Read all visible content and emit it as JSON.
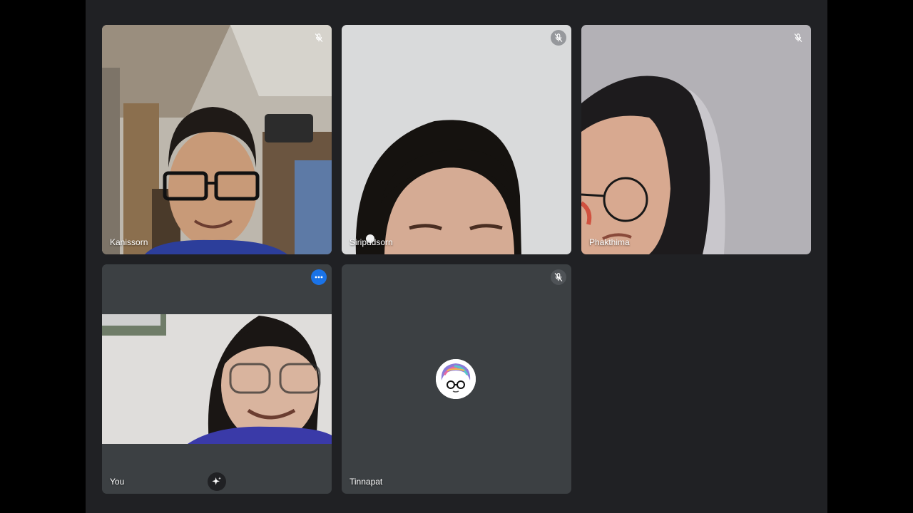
{
  "participants": [
    {
      "name": "Kanissorn",
      "muted": true,
      "mute_icon": "mic-off-icon"
    },
    {
      "name": "Siripudsorn",
      "muted": true,
      "mute_icon": "mic-off-icon"
    },
    {
      "name": "Phakthima",
      "muted": true,
      "mute_icon": "mic-off-icon"
    },
    {
      "name": "You",
      "more_icon": "more-options-icon",
      "effects_icon": "visual-effects-icon"
    },
    {
      "name": "Tinnapat",
      "muted": true,
      "mute_icon": "mic-off-icon",
      "avatar": "profile-avatar"
    }
  ],
  "colors": {
    "page_bg": "#000000",
    "stage_bg": "#202124",
    "tile_bg": "#3c4043",
    "accent": "#1a73e8",
    "text": "#ffffff"
  }
}
